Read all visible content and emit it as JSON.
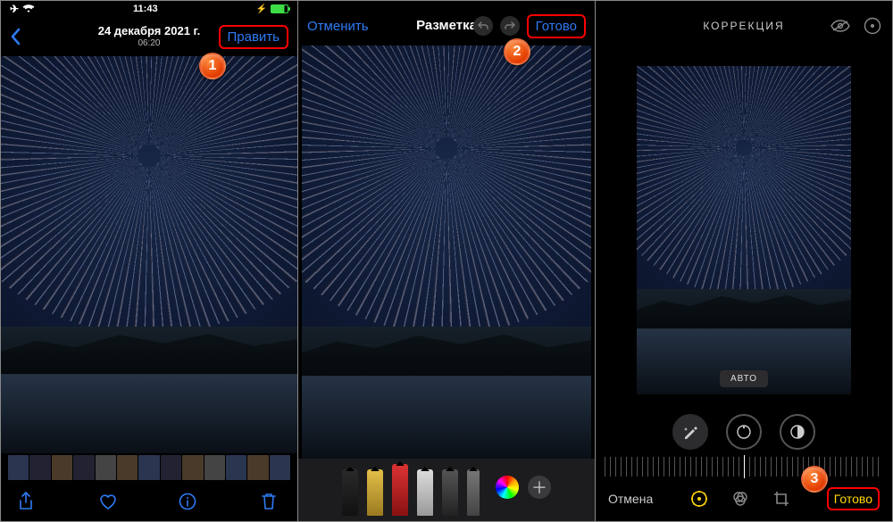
{
  "phone1": {
    "status": {
      "time": "11:43"
    },
    "nav": {
      "date": "24 декабря 2021 г.",
      "time": "06:20",
      "edit": "Править"
    },
    "badge": "1"
  },
  "phone2": {
    "nav": {
      "cancel": "Отменить",
      "title": "Разметка",
      "done": "Готово"
    },
    "badge": "2"
  },
  "phone3": {
    "nav": {
      "title": "КОРРЕКЦИЯ"
    },
    "auto": "АВТО",
    "bottom": {
      "cancel": "Отмена",
      "done": "Готово"
    },
    "badge": "3"
  }
}
